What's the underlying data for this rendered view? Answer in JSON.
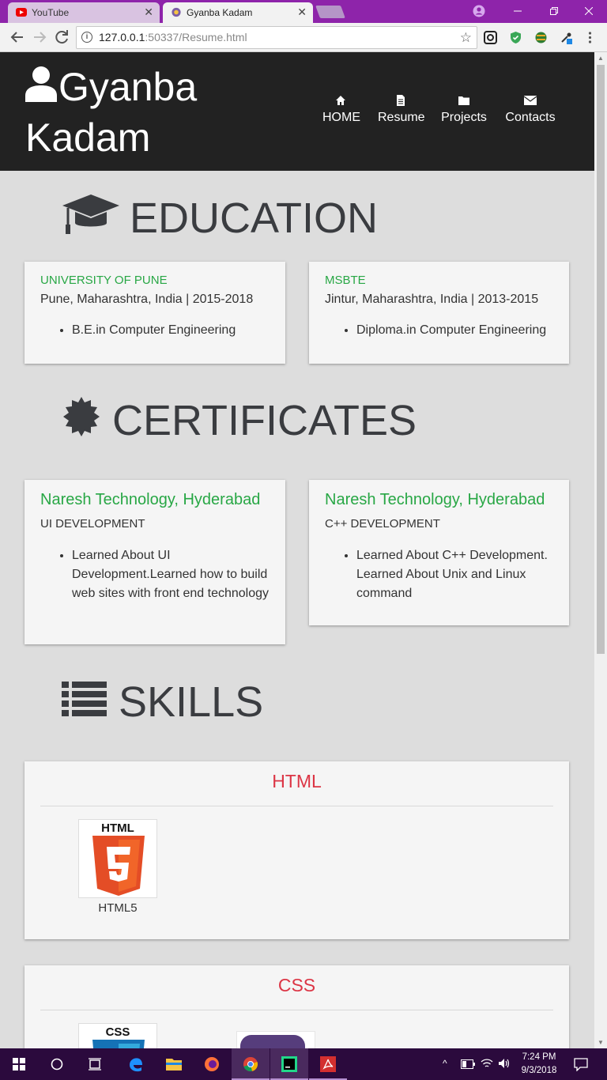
{
  "browser": {
    "tabs": [
      {
        "title": "YouTube",
        "close": "✕"
      },
      {
        "title": "Gyanba Kadam",
        "close": "✕"
      }
    ],
    "address": {
      "host": "127.0.0.1",
      "rest": ":50337/Resume.html"
    },
    "colors": {
      "frame": "#8e24aa"
    }
  },
  "header": {
    "brand": "Gyanba Kadam",
    "nav": [
      {
        "label": "HOME",
        "icon": "home-icon"
      },
      {
        "label": "Resume",
        "icon": "file-icon"
      },
      {
        "label": "Projects",
        "icon": "folder-icon"
      },
      {
        "label": "Contacts",
        "icon": "envelope-icon"
      }
    ]
  },
  "education": {
    "title": "EDUCATION",
    "icon": "graduation-cap-icon",
    "items": [
      {
        "institution": "UNIVERSITY OF PUNE",
        "location": "Pune, Maharashtra, India | 2015-2018",
        "detail": "B.E.in Computer Engineering"
      },
      {
        "institution": "MSBTE",
        "location": "Jintur, Maharashtra, India | 2013-2015",
        "detail": "Diploma.in Computer Engineering"
      }
    ]
  },
  "certificates": {
    "title": "CERTIFICATES",
    "icon": "certificate-icon",
    "items": [
      {
        "institute": "Naresh Technology, Hyderabad",
        "course": "UI DEVELOPMENT",
        "detail": "Learned About UI Development.Learned how to build web sites with front end technology"
      },
      {
        "institute": "Naresh Technology, Hyderabad",
        "course": "C++ DEVELOPMENT",
        "detail": "Learned About C++ Development. Learned About Unix and Linux command"
      }
    ]
  },
  "skills": {
    "title": "SKILLS",
    "icon": "list-icon",
    "groups": [
      {
        "name": "HTML",
        "items": [
          {
            "caption": "HTML5",
            "logo_text": "HTML",
            "badge": "5"
          }
        ]
      },
      {
        "name": "CSS",
        "items": [
          {
            "caption": "",
            "logo_text": "CSS"
          },
          {
            "caption": "",
            "logo_text": ""
          }
        ]
      }
    ]
  },
  "taskbar": {
    "time": "7:24 PM",
    "date": "9/3/2018"
  }
}
